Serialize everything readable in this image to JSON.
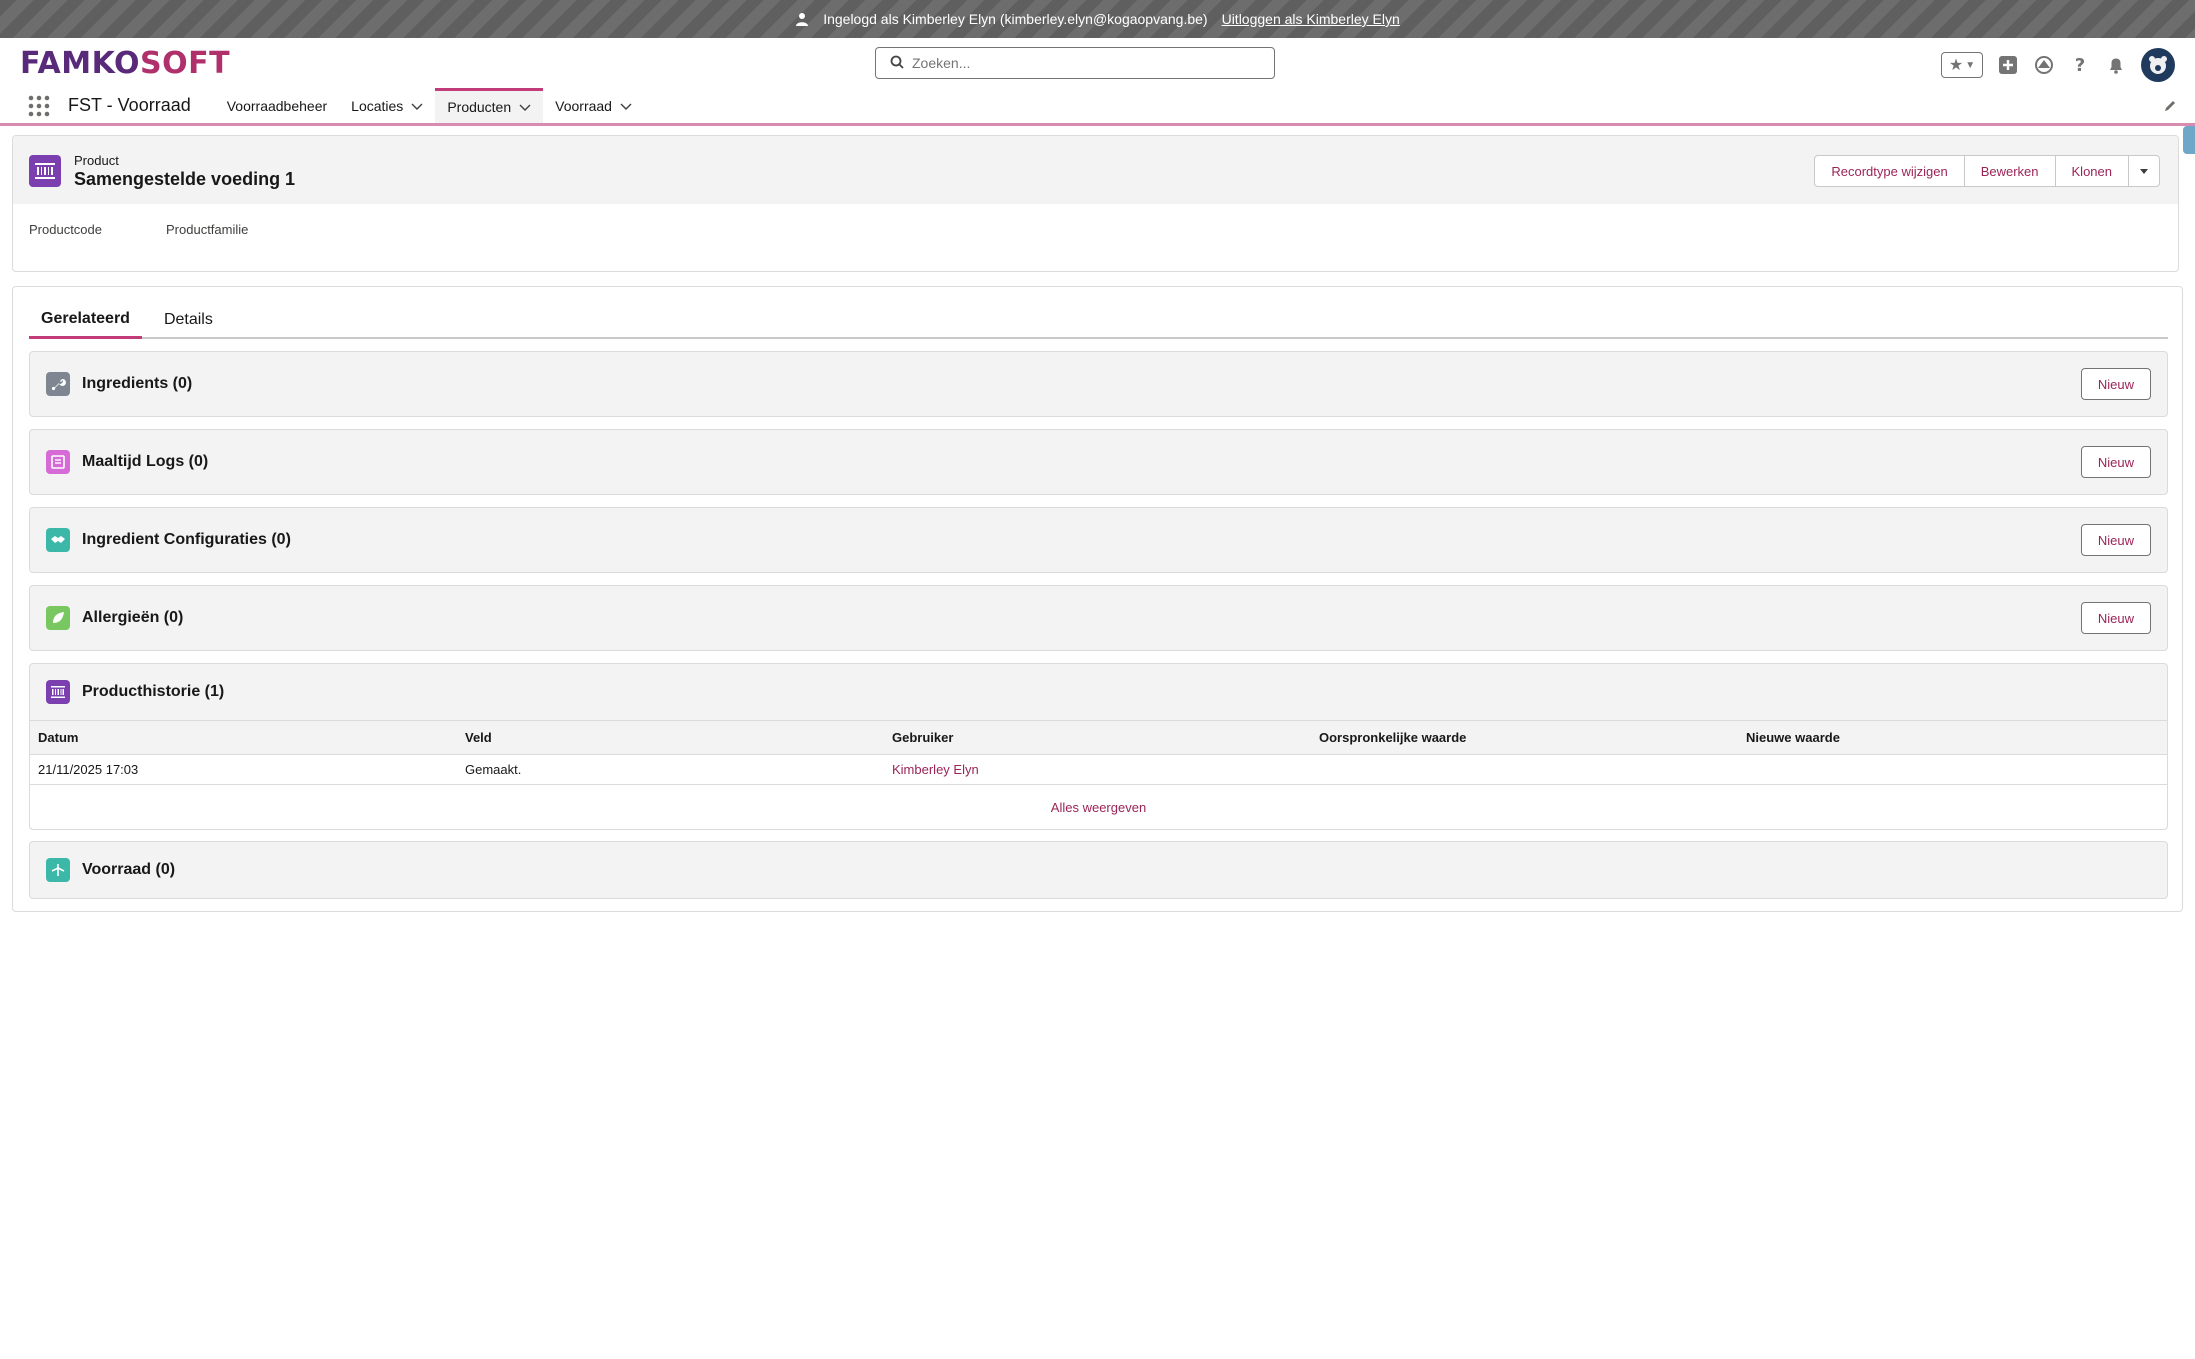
{
  "banner": {
    "text": "Ingelogd als Kimberley Elyn (kimberley.elyn@kogaopvang.be)",
    "logout_link": "Uitloggen als Kimberley Elyn"
  },
  "header": {
    "logo_part1": "FAMKO",
    "logo_part2": "SOFT",
    "search_placeholder": "Zoeken..."
  },
  "nav": {
    "app_name": "FST - Voorraad",
    "items": [
      {
        "label": "Voorraadbeheer"
      },
      {
        "label": "Locaties"
      },
      {
        "label": "Producten"
      },
      {
        "label": "Voorraad"
      }
    ]
  },
  "record": {
    "object_label": "Product",
    "title": "Samengestelde voeding 1",
    "buttons": {
      "change_type": "Recordtype wijzigen",
      "edit": "Bewerken",
      "clone": "Klonen"
    },
    "fields": {
      "code_label": "Productcode",
      "family_label": "Productfamilie"
    }
  },
  "tabs": [
    {
      "label": "Gerelateerd"
    },
    {
      "label": "Details"
    }
  ],
  "related_lists": {
    "ingredients": {
      "title": "Ingredients (0)",
      "new": "Nieuw"
    },
    "meal_logs": {
      "title": "Maaltijd Logs (0)",
      "new": "Nieuw"
    },
    "ingredient_configs": {
      "title": "Ingredient Configuraties (0)",
      "new": "Nieuw"
    },
    "allergies": {
      "title": "Allergieën (0)",
      "new": "Nieuw"
    },
    "history": {
      "title": "Producthistorie (1)",
      "columns": [
        "Datum",
        "Veld",
        "Gebruiker",
        "Oorspronkelijke waarde",
        "Nieuwe waarde"
      ],
      "rows": [
        {
          "date": "21/11/2025 17:03",
          "field": "Gemaakt.",
          "user": "Kimberley Elyn",
          "old": "",
          "new": ""
        }
      ],
      "view_all": "Alles weergeven"
    },
    "stock": {
      "title": "Voorraad (0)"
    }
  },
  "colors": {
    "brand": "#c23c7a",
    "link": "#9b2457",
    "product_icon": "#7b3fb0"
  }
}
